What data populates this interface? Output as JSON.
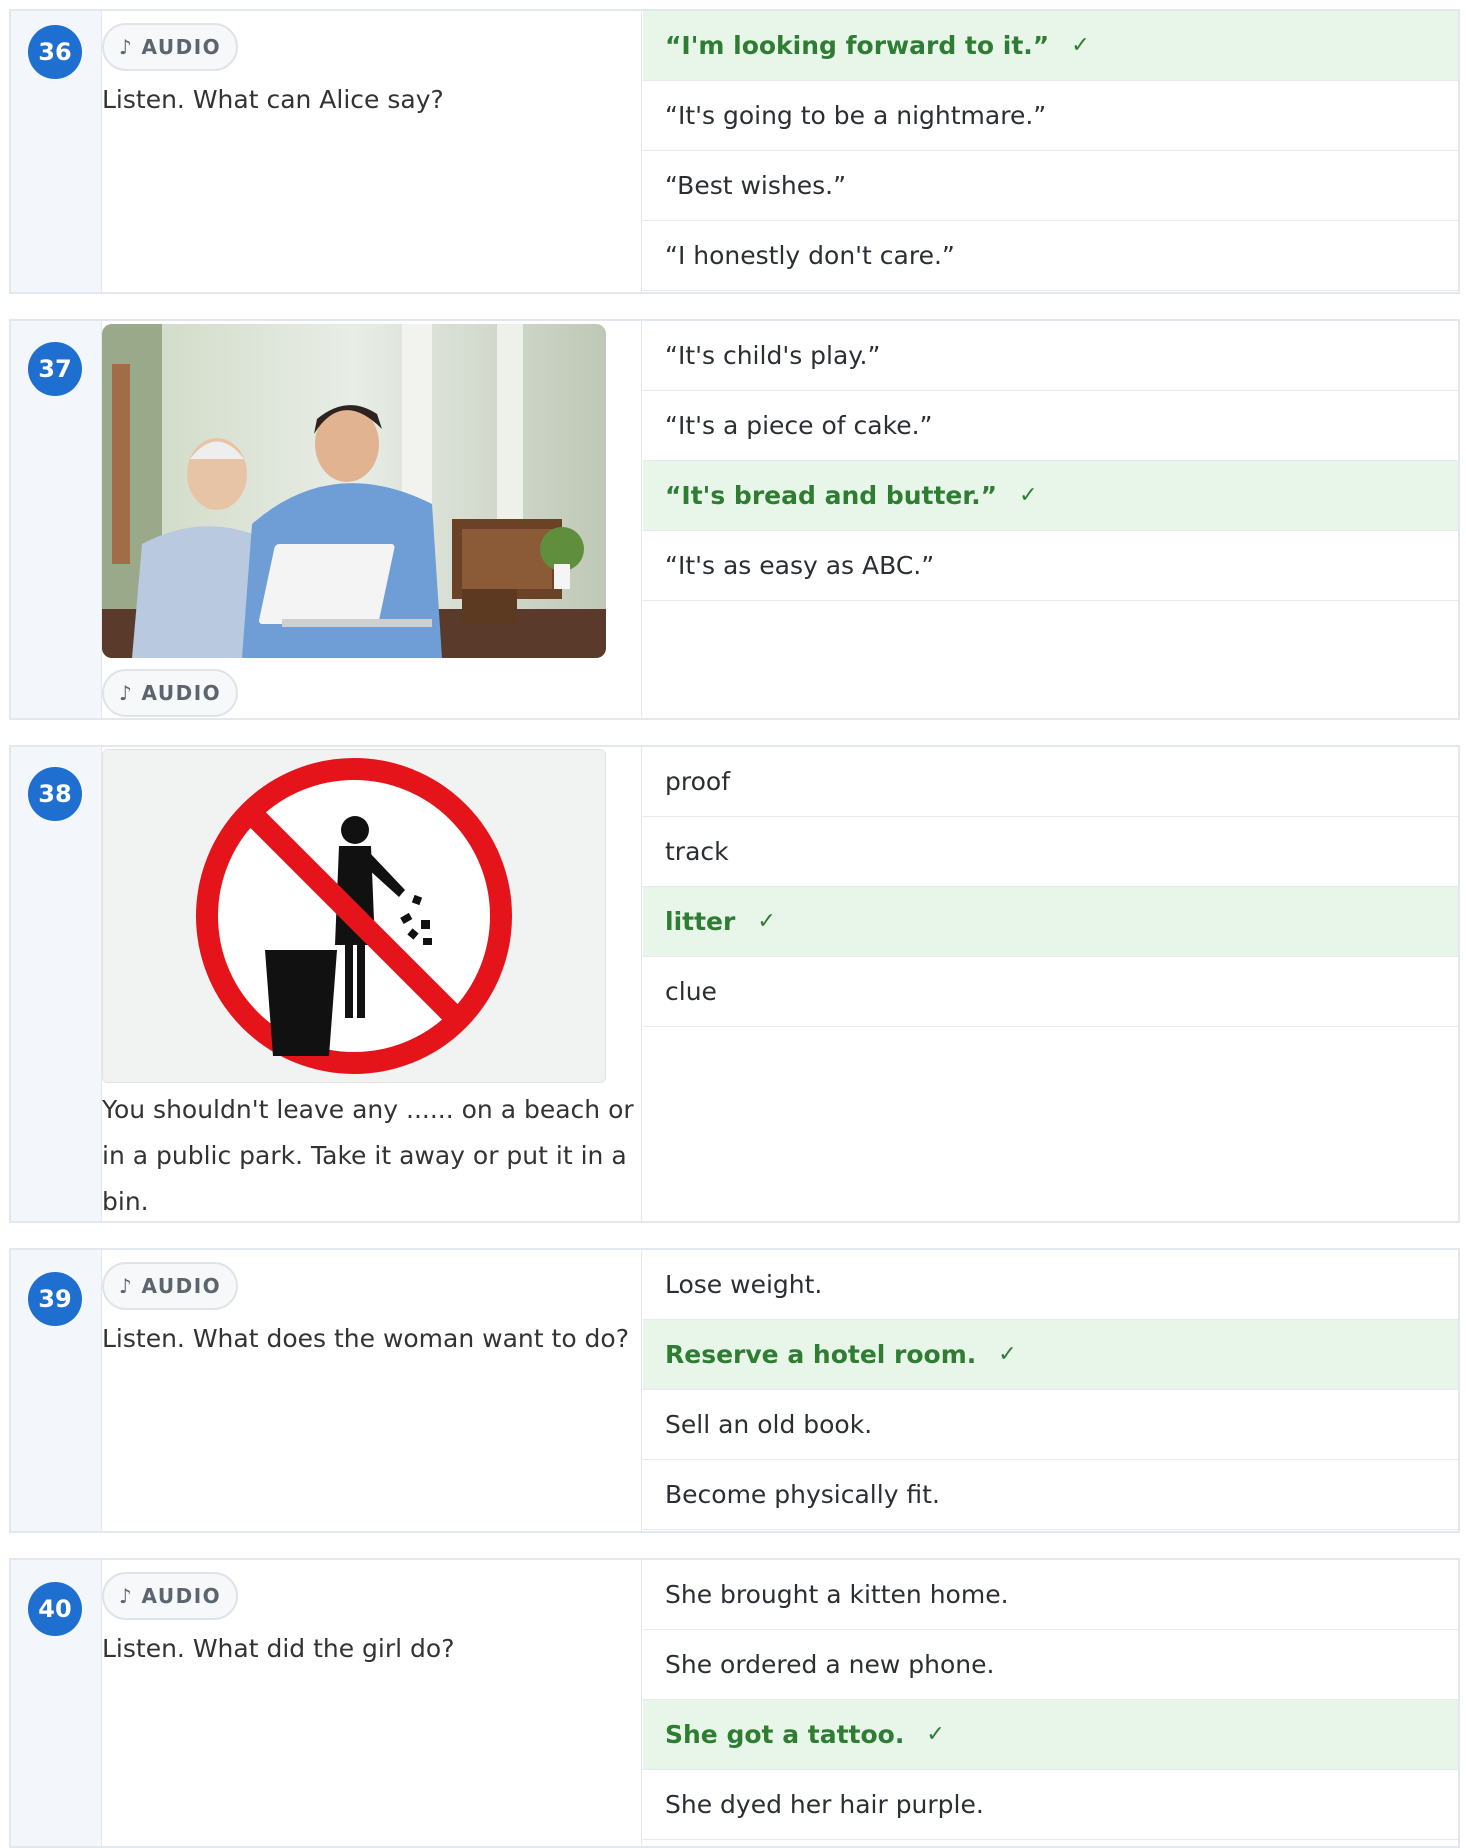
{
  "audio_label": "♪ AUDIO",
  "check_mark": "✓",
  "questions": [
    {
      "number": "36",
      "prompt": "Listen. What can Alice say?",
      "options": [
        "“I'm looking forward to it.”",
        "“It's going to be a nightmare.”",
        "“Best wishes.”",
        "“I honestly don't care.”"
      ],
      "correct_index": 0
    },
    {
      "number": "37",
      "image": "photo of a young man helping an elderly man use a laptop",
      "options": [
        "“It's child's play.”",
        "“It's a piece of cake.”",
        "“It's bread and butter.”",
        "“It's as easy as ABC.”"
      ],
      "correct_index": 2
    },
    {
      "number": "38",
      "image": "no-littering sign",
      "prompt": "You shouldn't leave any ...... on a beach or in a public park. Take it away or put it in a bin.",
      "options": [
        "proof",
        "track",
        "litter",
        "clue"
      ],
      "correct_index": 2
    },
    {
      "number": "39",
      "prompt": "Listen. What does the woman want to do?",
      "options": [
        "Lose weight.",
        "Reserve a hotel room.",
        "Sell an old book.",
        "Become physically fit."
      ],
      "correct_index": 1
    },
    {
      "number": "40",
      "prompt": "Listen. What did the girl do?",
      "options": [
        "She brought a kitten home.",
        "She ordered a new phone.",
        "She got a tattoo.",
        "She dyed her hair purple."
      ],
      "correct_index": 2
    }
  ],
  "colors": {
    "accent": "#1f6fd0",
    "correct_bg": "#e8f5e9",
    "correct_text": "#2e7d32",
    "border": "#e3e8ee"
  }
}
